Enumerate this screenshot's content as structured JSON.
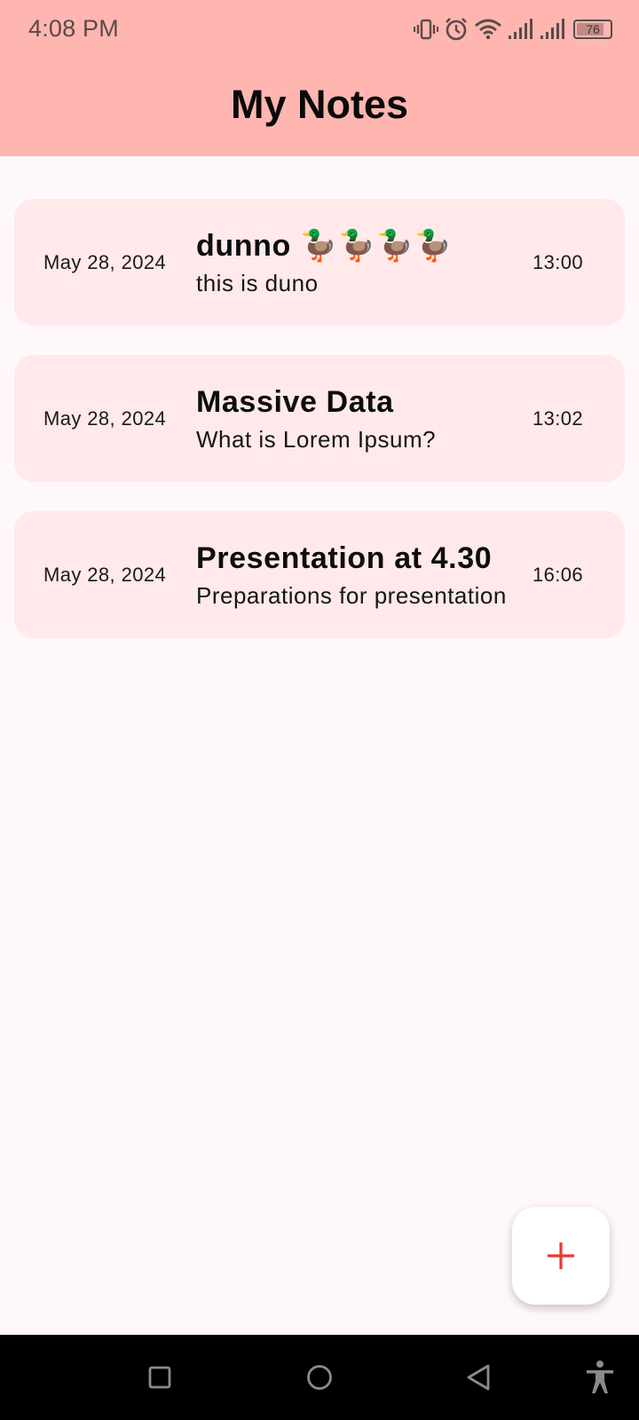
{
  "status_bar": {
    "time": "4:08 PM",
    "battery_level": "76",
    "icons": [
      "vibrate-icon",
      "alarm-icon",
      "wifi-icon",
      "signal-icon",
      "signal-icon",
      "battery-icon"
    ]
  },
  "app_bar": {
    "title": "My Notes"
  },
  "notes": [
    {
      "date": "May 28, 2024",
      "title": "dunno 🦆🦆🦆🦆",
      "preview": "this is duno",
      "time": "13:00"
    },
    {
      "date": "May 28, 2024",
      "title": "Massive Data",
      "preview": "What is Lorem Ipsum?",
      "time": "13:02"
    },
    {
      "date": "May 28, 2024",
      "title": "Presentation at 4.30",
      "preview": "Preparations for presentation",
      "time": "16:06"
    }
  ],
  "fab": {
    "icon": "plus-icon"
  },
  "nav_bar": {
    "icons": [
      "recents-icon",
      "home-icon",
      "back-icon",
      "accessibility-icon"
    ]
  },
  "colors": {
    "app_bar": "#ffb6b1",
    "card": "#ffe9ea",
    "background": "#fff8fb",
    "fab_icon": "#e53935"
  }
}
